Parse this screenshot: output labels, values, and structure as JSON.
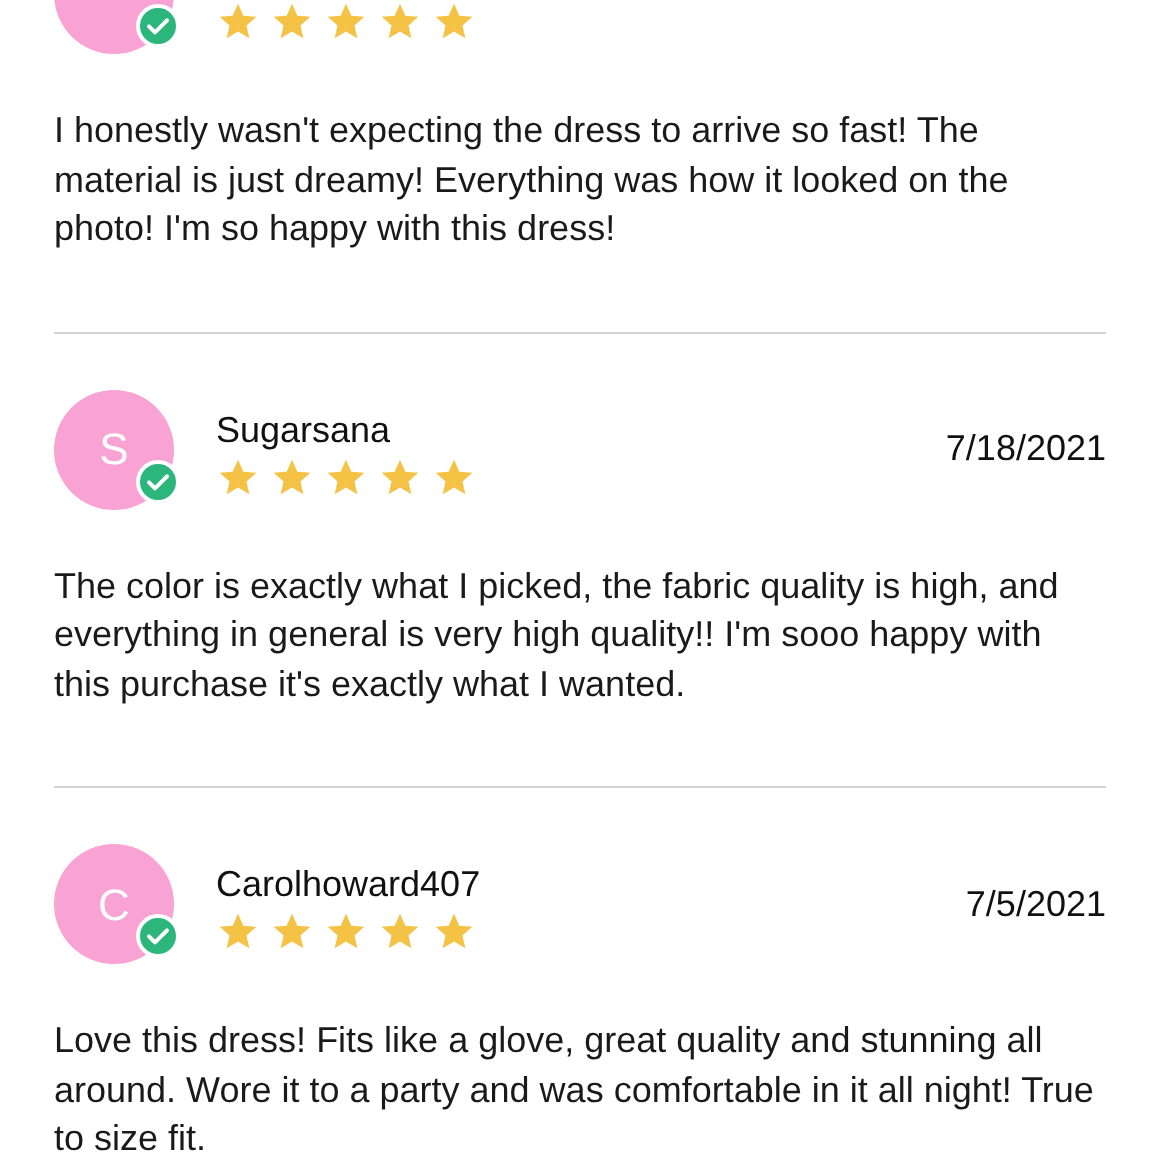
{
  "reviews": [
    {
      "verified": true,
      "stars": 5,
      "text": "I honestly wasn't expecting the dress to arrive so fast! The material is just dreamy! Everything was how it looked on the photo! I'm so happy with this dress!"
    },
    {
      "initial": "S",
      "name": "Sugarsana",
      "verified": true,
      "stars": 5,
      "date": "7/18/2021",
      "text": "The color is exactly what I picked, the fabric quality is high, and everything in general is very high quality!! I'm sooo happy with this purchase it's exactly what I wanted."
    },
    {
      "initial": "C",
      "name": "Carolhoward407",
      "verified": true,
      "stars": 5,
      "date": "7/5/2021",
      "text": "Love this dress! Fits like a glove, great quality and stunning all around. Wore it to a party and was comfortable in it all night! True to size fit."
    }
  ]
}
